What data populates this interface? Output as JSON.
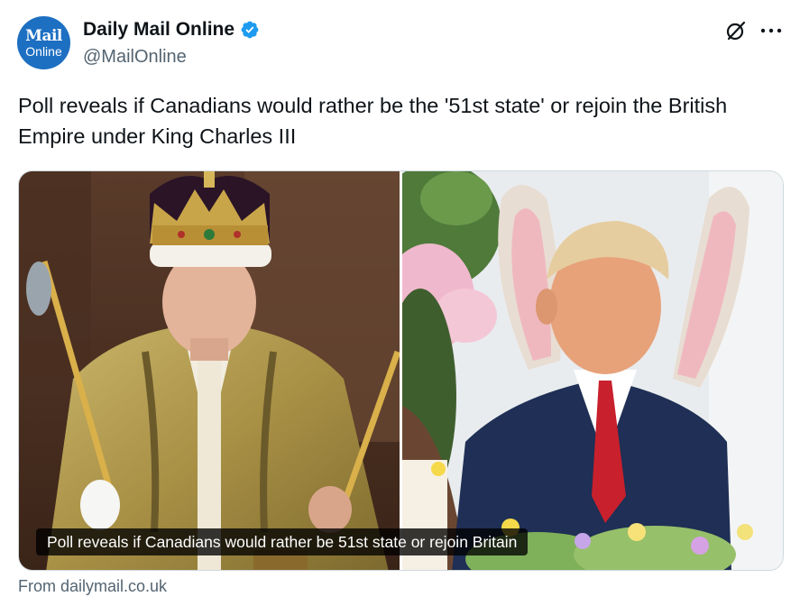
{
  "author": {
    "avatar_line1": "Mail",
    "avatar_line2": "Online",
    "display_name": "Daily Mail Online",
    "handle": "@MailOnline",
    "verified": true
  },
  "tweet": {
    "text": "Poll reveals if Canadians would rather be the '51st state' or rejoin the British Empire under King Charles III"
  },
  "card": {
    "caption": "Poll reveals if Canadians would rather be 51st state or rejoin Britain",
    "source": "From dailymail.co.uk"
  },
  "icons": {
    "verified": "verified-badge-icon",
    "grok": "grok-icon",
    "more": "more-icon"
  },
  "colors": {
    "brand_blue": "#1d6fc2",
    "verified_blue": "#1d9bf0",
    "text_primary": "#0f1419",
    "text_secondary": "#536471"
  }
}
